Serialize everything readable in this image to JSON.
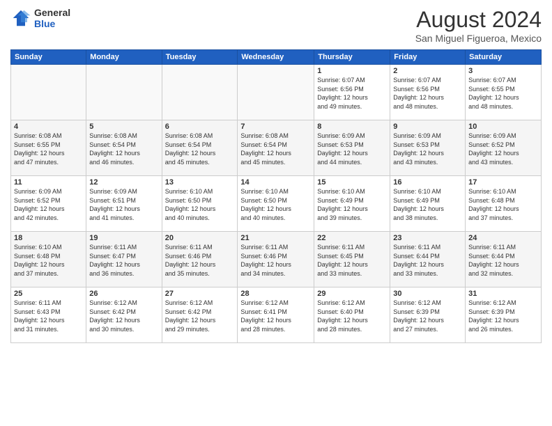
{
  "logo": {
    "general": "General",
    "blue": "Blue"
  },
  "header": {
    "month_year": "August 2024",
    "location": "San Miguel Figueroa, Mexico"
  },
  "days_of_week": [
    "Sunday",
    "Monday",
    "Tuesday",
    "Wednesday",
    "Thursday",
    "Friday",
    "Saturday"
  ],
  "weeks": [
    [
      {
        "day": "",
        "info": ""
      },
      {
        "day": "",
        "info": ""
      },
      {
        "day": "",
        "info": ""
      },
      {
        "day": "",
        "info": ""
      },
      {
        "day": "1",
        "info": "Sunrise: 6:07 AM\nSunset: 6:56 PM\nDaylight: 12 hours\nand 49 minutes."
      },
      {
        "day": "2",
        "info": "Sunrise: 6:07 AM\nSunset: 6:56 PM\nDaylight: 12 hours\nand 48 minutes."
      },
      {
        "day": "3",
        "info": "Sunrise: 6:07 AM\nSunset: 6:55 PM\nDaylight: 12 hours\nand 48 minutes."
      }
    ],
    [
      {
        "day": "4",
        "info": "Sunrise: 6:08 AM\nSunset: 6:55 PM\nDaylight: 12 hours\nand 47 minutes."
      },
      {
        "day": "5",
        "info": "Sunrise: 6:08 AM\nSunset: 6:54 PM\nDaylight: 12 hours\nand 46 minutes."
      },
      {
        "day": "6",
        "info": "Sunrise: 6:08 AM\nSunset: 6:54 PM\nDaylight: 12 hours\nand 45 minutes."
      },
      {
        "day": "7",
        "info": "Sunrise: 6:08 AM\nSunset: 6:54 PM\nDaylight: 12 hours\nand 45 minutes."
      },
      {
        "day": "8",
        "info": "Sunrise: 6:09 AM\nSunset: 6:53 PM\nDaylight: 12 hours\nand 44 minutes."
      },
      {
        "day": "9",
        "info": "Sunrise: 6:09 AM\nSunset: 6:53 PM\nDaylight: 12 hours\nand 43 minutes."
      },
      {
        "day": "10",
        "info": "Sunrise: 6:09 AM\nSunset: 6:52 PM\nDaylight: 12 hours\nand 43 minutes."
      }
    ],
    [
      {
        "day": "11",
        "info": "Sunrise: 6:09 AM\nSunset: 6:52 PM\nDaylight: 12 hours\nand 42 minutes."
      },
      {
        "day": "12",
        "info": "Sunrise: 6:09 AM\nSunset: 6:51 PM\nDaylight: 12 hours\nand 41 minutes."
      },
      {
        "day": "13",
        "info": "Sunrise: 6:10 AM\nSunset: 6:50 PM\nDaylight: 12 hours\nand 40 minutes."
      },
      {
        "day": "14",
        "info": "Sunrise: 6:10 AM\nSunset: 6:50 PM\nDaylight: 12 hours\nand 40 minutes."
      },
      {
        "day": "15",
        "info": "Sunrise: 6:10 AM\nSunset: 6:49 PM\nDaylight: 12 hours\nand 39 minutes."
      },
      {
        "day": "16",
        "info": "Sunrise: 6:10 AM\nSunset: 6:49 PM\nDaylight: 12 hours\nand 38 minutes."
      },
      {
        "day": "17",
        "info": "Sunrise: 6:10 AM\nSunset: 6:48 PM\nDaylight: 12 hours\nand 37 minutes."
      }
    ],
    [
      {
        "day": "18",
        "info": "Sunrise: 6:10 AM\nSunset: 6:48 PM\nDaylight: 12 hours\nand 37 minutes."
      },
      {
        "day": "19",
        "info": "Sunrise: 6:11 AM\nSunset: 6:47 PM\nDaylight: 12 hours\nand 36 minutes."
      },
      {
        "day": "20",
        "info": "Sunrise: 6:11 AM\nSunset: 6:46 PM\nDaylight: 12 hours\nand 35 minutes."
      },
      {
        "day": "21",
        "info": "Sunrise: 6:11 AM\nSunset: 6:46 PM\nDaylight: 12 hours\nand 34 minutes."
      },
      {
        "day": "22",
        "info": "Sunrise: 6:11 AM\nSunset: 6:45 PM\nDaylight: 12 hours\nand 33 minutes."
      },
      {
        "day": "23",
        "info": "Sunrise: 6:11 AM\nSunset: 6:44 PM\nDaylight: 12 hours\nand 33 minutes."
      },
      {
        "day": "24",
        "info": "Sunrise: 6:11 AM\nSunset: 6:44 PM\nDaylight: 12 hours\nand 32 minutes."
      }
    ],
    [
      {
        "day": "25",
        "info": "Sunrise: 6:11 AM\nSunset: 6:43 PM\nDaylight: 12 hours\nand 31 minutes."
      },
      {
        "day": "26",
        "info": "Sunrise: 6:12 AM\nSunset: 6:42 PM\nDaylight: 12 hours\nand 30 minutes."
      },
      {
        "day": "27",
        "info": "Sunrise: 6:12 AM\nSunset: 6:42 PM\nDaylight: 12 hours\nand 29 minutes."
      },
      {
        "day": "28",
        "info": "Sunrise: 6:12 AM\nSunset: 6:41 PM\nDaylight: 12 hours\nand 28 minutes."
      },
      {
        "day": "29",
        "info": "Sunrise: 6:12 AM\nSunset: 6:40 PM\nDaylight: 12 hours\nand 28 minutes."
      },
      {
        "day": "30",
        "info": "Sunrise: 6:12 AM\nSunset: 6:39 PM\nDaylight: 12 hours\nand 27 minutes."
      },
      {
        "day": "31",
        "info": "Sunrise: 6:12 AM\nSunset: 6:39 PM\nDaylight: 12 hours\nand 26 minutes."
      }
    ]
  ]
}
